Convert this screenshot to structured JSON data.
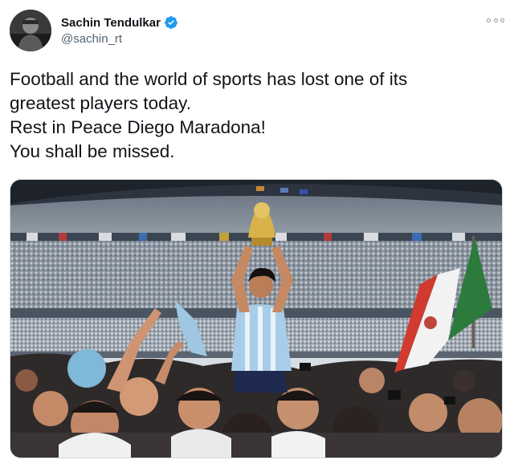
{
  "author": {
    "display_name": "Sachin Tendulkar",
    "handle": "@sachin_rt",
    "verified": true
  },
  "tweet": {
    "lines": [
      "Football and the world of sports has lost one of its",
      "greatest players today.",
      "Rest in Peace Diego Maradona!",
      "You shall be missed."
    ]
  },
  "icons": {
    "verified": "verified-badge-icon",
    "more": "more-options-icon"
  },
  "colors": {
    "verified_blue": "#1d9bf0",
    "text": "#0f1419",
    "secondary_text": "#536471"
  }
}
